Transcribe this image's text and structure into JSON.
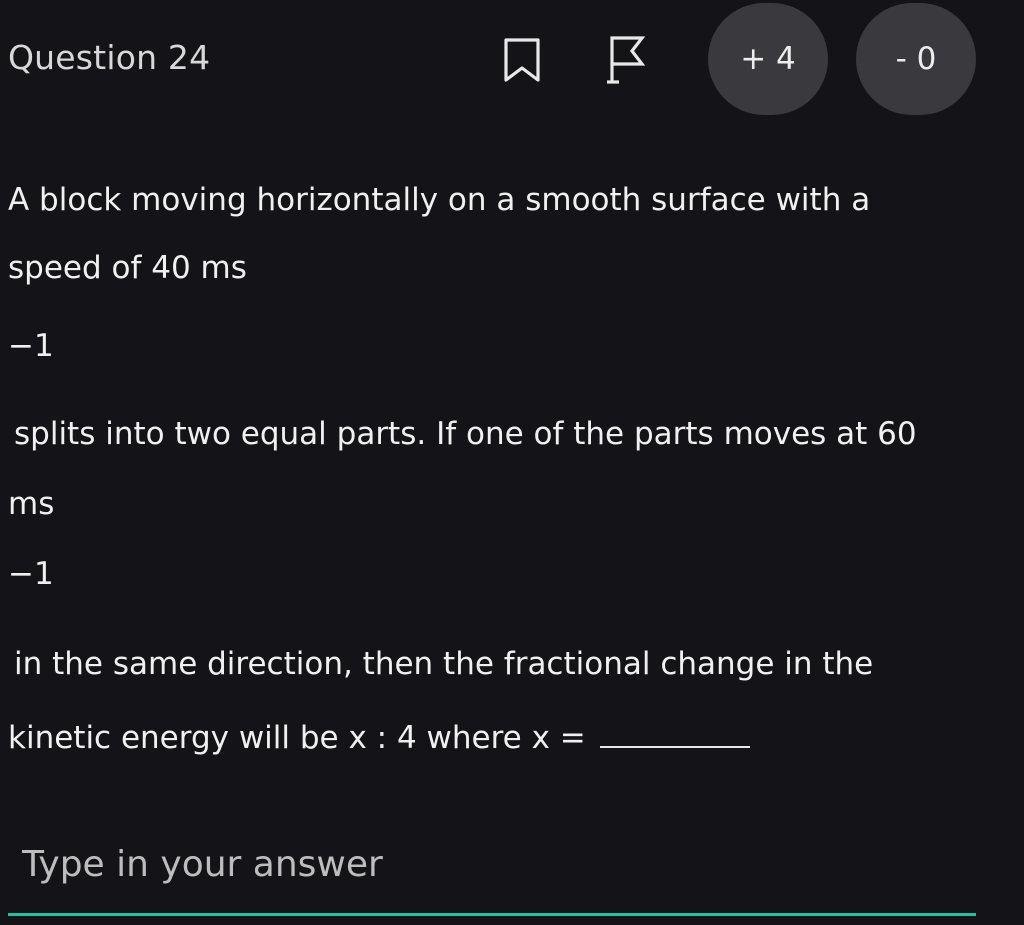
{
  "header": {
    "title": "Question 24",
    "bookmark_icon": "bookmark-icon",
    "flag_icon": "flag-icon",
    "positive_marks": "+ 4",
    "negative_marks": "- 0"
  },
  "question": {
    "lines": [
      "A block moving horizontally on a smooth surface with a",
      "speed of 40 ms",
      "−1",
      "splits into two equal parts. If one of the parts moves at 60",
      "ms",
      "−1",
      "in the same direction, then the fractional change in the",
      "kinetic energy will be x : 4 where x ="
    ]
  },
  "answer": {
    "placeholder": "Type in your answer",
    "value": ""
  },
  "colors": {
    "background": "#141418",
    "pill": "#3a3a3e",
    "accent_underline": "#2dbba4"
  }
}
